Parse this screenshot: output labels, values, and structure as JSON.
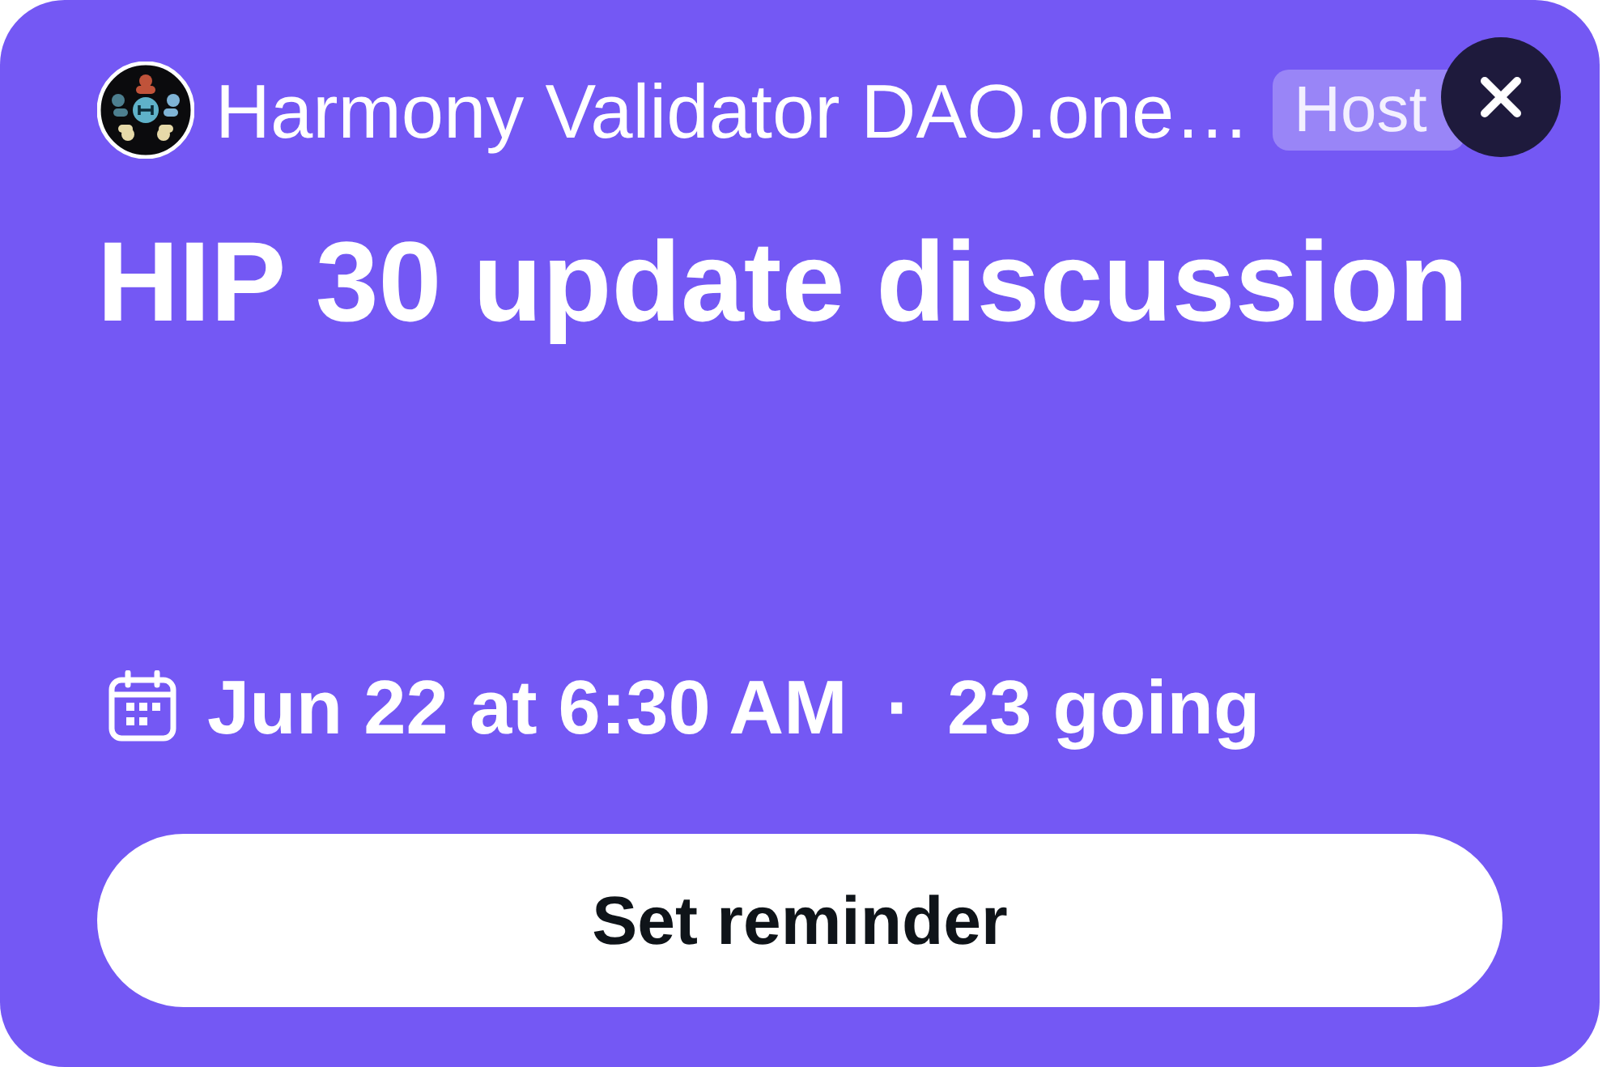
{
  "host": {
    "name": "Harmony Validator DAO.one…",
    "role": "Host"
  },
  "title": "HIP 30 update discussion",
  "schedule": {
    "date": "Jun 22 at 6:30 AM",
    "separator": "·",
    "attendance": "23 going"
  },
  "button": {
    "label": "Set reminder"
  }
}
